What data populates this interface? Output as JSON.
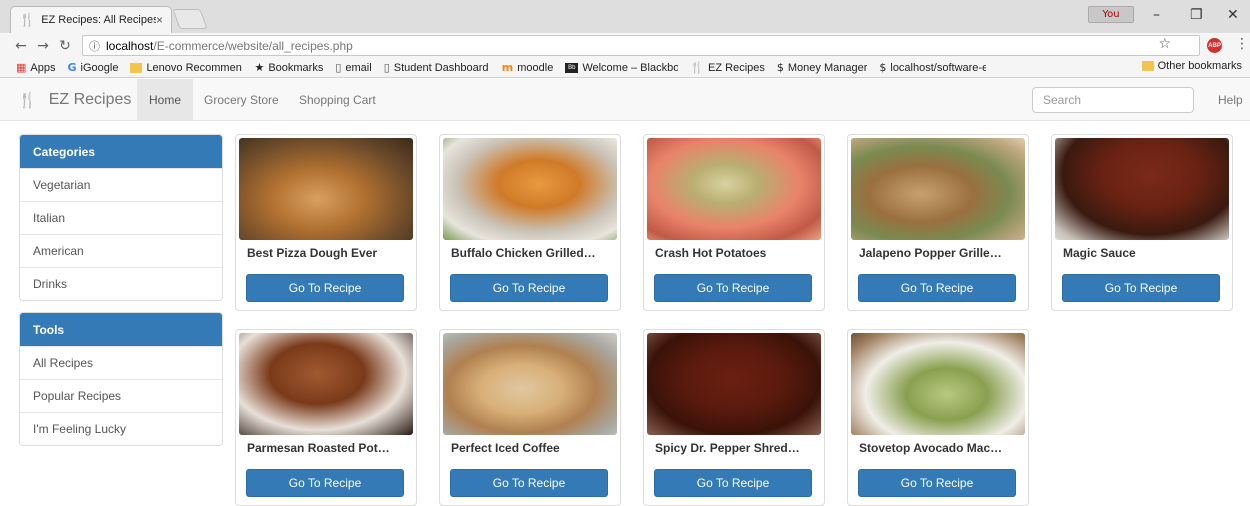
{
  "browser": {
    "tab_title": "EZ Recipes: All Recipes",
    "tab_close": "×",
    "profile_label": "You",
    "url_host": "localhost",
    "url_path": "/E-commerce/website/all_recipes.php",
    "bookmarks": [
      {
        "label": "Apps",
        "icon": "apps-icon"
      },
      {
        "label": "iGoogle",
        "icon": "google-icon"
      },
      {
        "label": "Lenovo Recommende",
        "icon": "folder-icon"
      },
      {
        "label": "Bookmarks",
        "icon": "star-icon"
      },
      {
        "label": "email",
        "icon": "page-icon"
      },
      {
        "label": "Student Dashboard H",
        "icon": "page-icon"
      },
      {
        "label": "moodle",
        "icon": "moodle-icon"
      },
      {
        "label": "Welcome – Blackboar",
        "icon": "blackboard-icon"
      },
      {
        "label": "EZ Recipes",
        "icon": "utensils-icon"
      },
      {
        "label": "Money Manager",
        "icon": "dollar-icon"
      },
      {
        "label": "localhost/software-en",
        "icon": "dollar-icon"
      }
    ],
    "other_bookmarks": "Other bookmarks"
  },
  "navbar": {
    "brand": "EZ Recipes",
    "items": [
      "Home",
      "Grocery Store",
      "Shopping Cart"
    ],
    "active_item": "Home",
    "search_placeholder": "Search",
    "help": "Help"
  },
  "sidebar": {
    "categories": {
      "title": "Categories",
      "items": [
        "Vegetarian",
        "Italian",
        "American",
        "Drinks"
      ]
    },
    "tools": {
      "title": "Tools",
      "items": [
        "All Recipes",
        "Popular Recipes",
        "I'm Feeling Lucky"
      ]
    }
  },
  "recipes": [
    {
      "name": "Best Pizza Dough Ever",
      "button": "Go To Recipe"
    },
    {
      "name": "Buffalo Chicken Grilled…",
      "button": "Go To Recipe"
    },
    {
      "name": "Crash Hot Potatoes",
      "button": "Go To Recipe"
    },
    {
      "name": "Jalapeno Popper Grille…",
      "button": "Go To Recipe"
    },
    {
      "name": "Magic Sauce",
      "button": "Go To Recipe"
    },
    {
      "name": "Parmesan Roasted Pot…",
      "button": "Go To Recipe"
    },
    {
      "name": "Perfect Iced Coffee",
      "button": "Go To Recipe"
    },
    {
      "name": "Spicy Dr. Pepper Shred…",
      "button": "Go To Recipe"
    },
    {
      "name": "Stovetop Avocado Mac…",
      "button": "Go To Recipe"
    }
  ],
  "colors": {
    "primary": "#337ab7",
    "navbar_bg": "#f8f8f8",
    "active_nav_bg": "#e7e7e7"
  }
}
